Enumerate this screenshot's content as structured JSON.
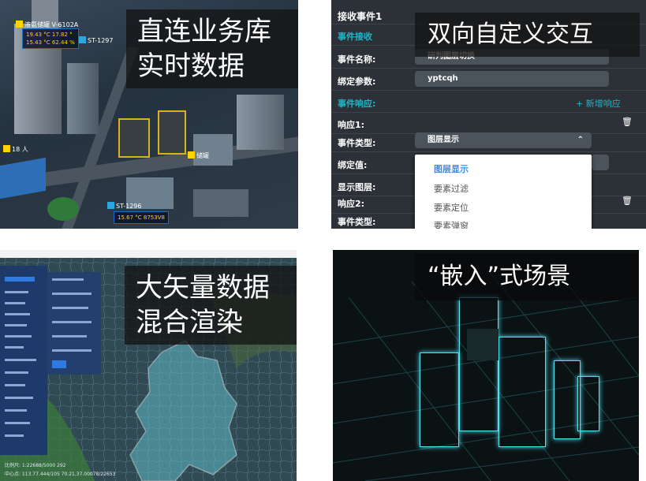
{
  "panels": {
    "p1": {
      "caption_line1": "直连业务库",
      "caption_line2": "实时数据",
      "tags": {
        "tank": "液氨储罐 V-6102A",
        "st1297": "ST-1297",
        "st1296": "ST-1296",
        "tank_label": "储罐",
        "people": "18 人"
      },
      "infobox1": {
        "line1": "19.43 °C  17.82 °",
        "line2": "15.43 °C  62.44 %"
      },
      "infobox2": {
        "line1": "15.67 °C  8753V8"
      }
    },
    "p2": {
      "caption": "双向自定义交互",
      "header": "接收事件1",
      "section_receive": "事件接收",
      "event_name_label": "事件名称:",
      "event_name_value": "研判图层切换",
      "bind_param_label": "绑定参数:",
      "bind_param_value": "yptcqh",
      "section_response": "事件响应:",
      "add_response": "+ 新增响应",
      "response1": "响应1:",
      "event_type_label": "事件类型:",
      "event_type_value": "图层显示",
      "bind_value_label": "绑定值:",
      "display_layer_label": "显示图层:",
      "response2": "响应2:",
      "event_type_label2": "事件类型:",
      "dropdown": [
        "图层显示",
        "要素过滤",
        "要素定位",
        "要素弹窗"
      ]
    },
    "p3": {
      "caption_line1": "大矢量数据",
      "caption_line2": "混合渲染",
      "status_line1": "比例尺: 1:22688/5000 292",
      "status_line2": "中心点: 113.77.444/105 70.21,37.00078/22653"
    },
    "p4": {
      "caption": "“嵌入”式场景"
    }
  },
  "colors": {
    "accent_teal": "#1fb6c7",
    "accent_blue": "#3b8be9",
    "wire_cyan": "#4fe3f0"
  }
}
